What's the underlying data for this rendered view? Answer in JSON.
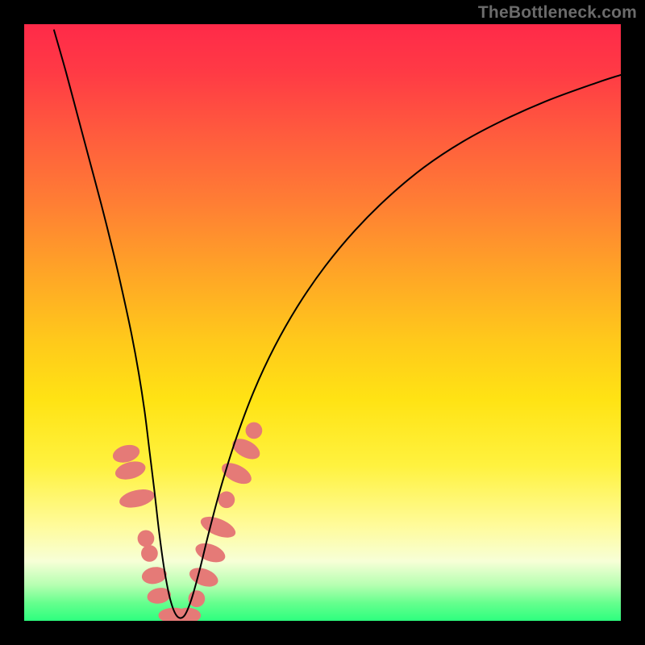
{
  "watermark": "TheBottleneck.com",
  "chart_data": {
    "type": "line",
    "title": "",
    "xlabel": "",
    "ylabel": "",
    "xlim": [
      0,
      100
    ],
    "ylim": [
      0,
      100
    ],
    "grid": false,
    "legend": false,
    "curve": {
      "x": [
        5,
        7,
        9,
        11,
        13,
        15,
        16.5,
        18,
        19.2,
        20.2,
        21,
        21.8,
        22.6,
        23.5,
        24.5,
        25.6,
        26.8,
        28,
        29.4,
        31,
        33,
        35.5,
        38.5,
        42,
        46,
        50.5,
        55.5,
        61,
        67,
        73.5,
        80.5,
        88,
        96,
        100
      ],
      "y": [
        99,
        92,
        84.5,
        77,
        69.5,
        61.5,
        55,
        48,
        41.5,
        35,
        28.5,
        22,
        15,
        8.5,
        3.5,
        0.8,
        0.8,
        3.5,
        8.5,
        15,
        22.5,
        30.5,
        38.5,
        46,
        53,
        59.5,
        65.5,
        71,
        76,
        80.3,
        84,
        87.3,
        90.2,
        91.5
      ]
    },
    "markers": [
      {
        "shape": "ellipse",
        "cx": 17.1,
        "cy": 28.0,
        "rx": 1.4,
        "ry": 2.3,
        "rot": 75
      },
      {
        "shape": "ellipse",
        "cx": 17.8,
        "cy": 25.2,
        "rx": 1.4,
        "ry": 2.6,
        "rot": 75
      },
      {
        "shape": "ellipse",
        "cx": 18.9,
        "cy": 20.5,
        "rx": 1.4,
        "ry": 3.0,
        "rot": 77
      },
      {
        "shape": "circle",
        "cx": 20.4,
        "cy": 13.8,
        "r": 1.4
      },
      {
        "shape": "circle",
        "cx": 21.0,
        "cy": 11.3,
        "r": 1.4
      },
      {
        "shape": "ellipse",
        "cx": 21.8,
        "cy": 7.6,
        "rx": 1.4,
        "ry": 2.1,
        "rot": 80
      },
      {
        "shape": "ellipse",
        "cx": 22.6,
        "cy": 4.2,
        "rx": 1.3,
        "ry": 2.0,
        "rot": 80
      },
      {
        "shape": "ellipse",
        "cx": 25.1,
        "cy": 0.9,
        "rx": 2.6,
        "ry": 1.3,
        "rot": 0
      },
      {
        "shape": "ellipse",
        "cx": 27.4,
        "cy": 0.9,
        "rx": 2.2,
        "ry": 1.3,
        "rot": 0
      },
      {
        "shape": "circle",
        "cx": 28.9,
        "cy": 3.7,
        "r": 1.4
      },
      {
        "shape": "ellipse",
        "cx": 30.1,
        "cy": 7.3,
        "rx": 1.4,
        "ry": 2.5,
        "rot": -70
      },
      {
        "shape": "ellipse",
        "cx": 31.2,
        "cy": 11.4,
        "rx": 1.4,
        "ry": 2.6,
        "rot": -70
      },
      {
        "shape": "ellipse",
        "cx": 32.5,
        "cy": 15.7,
        "rx": 1.4,
        "ry": 3.1,
        "rot": -68
      },
      {
        "shape": "circle",
        "cx": 33.9,
        "cy": 20.3,
        "r": 1.4
      },
      {
        "shape": "ellipse",
        "cx": 35.6,
        "cy": 24.7,
        "rx": 1.4,
        "ry": 2.7,
        "rot": -63
      },
      {
        "shape": "ellipse",
        "cx": 37.2,
        "cy": 28.8,
        "rx": 1.4,
        "ry": 2.5,
        "rot": -62
      },
      {
        "shape": "circle",
        "cx": 38.5,
        "cy": 31.9,
        "r": 1.4
      }
    ],
    "colors": {
      "curve": "#000000",
      "marker": "#e57a77",
      "gradient_top": "#ff2a49",
      "gradient_bottom": "#2dff7e"
    },
    "notes": "V-shaped bottleneck curve over a red-to-green vertical gradient. No axis ticks or numeric labels are visible; x/y are normalized 0-100. Salmon markers cluster near the trough on both branches."
  }
}
